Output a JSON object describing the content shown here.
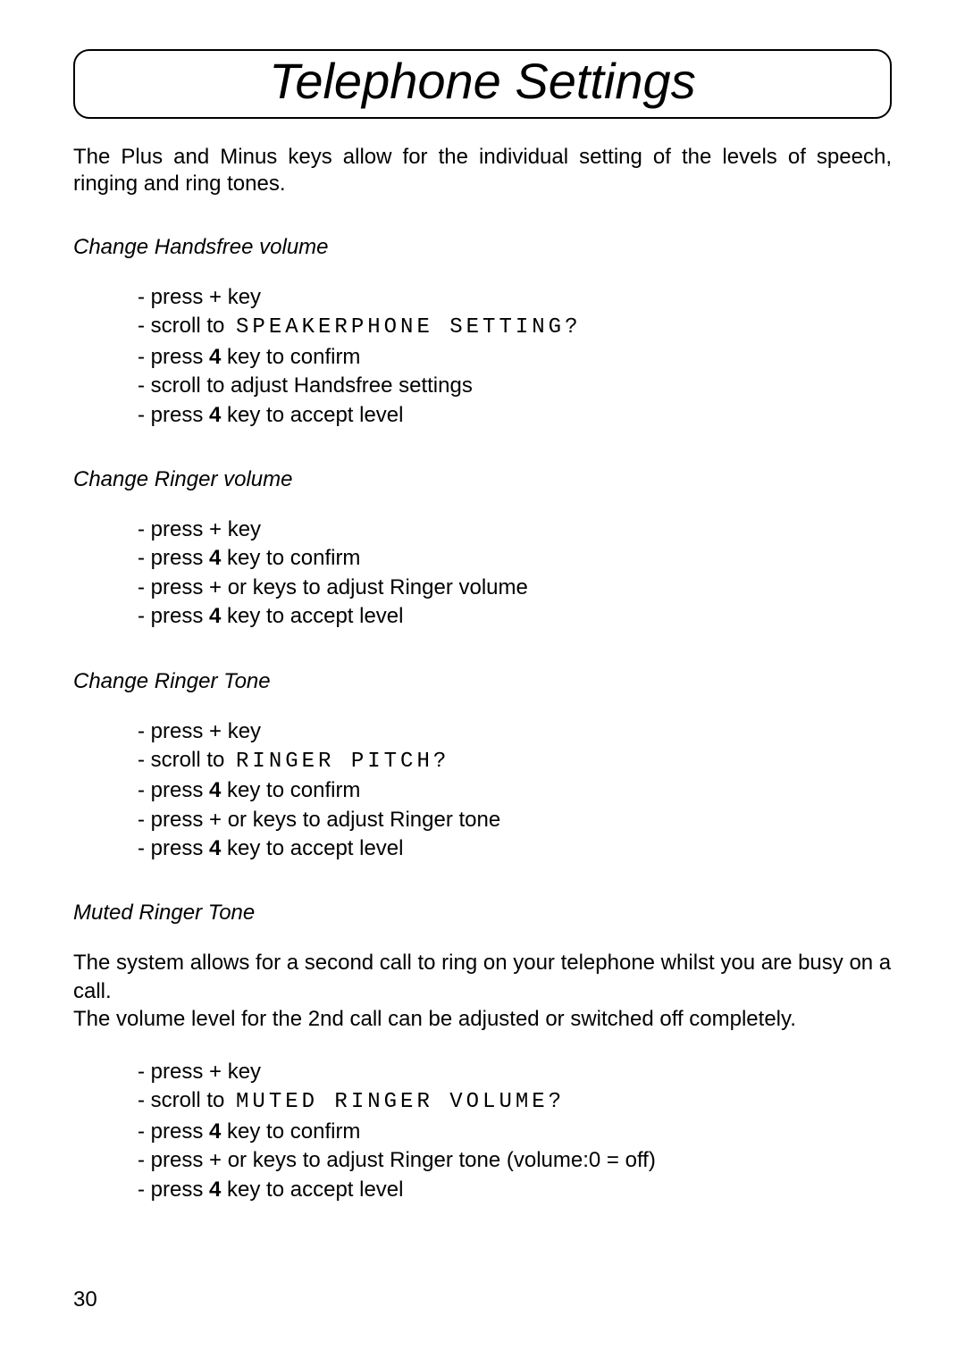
{
  "title": "Telephone Settings",
  "intro": "The Plus and Minus keys allow for the individual setting of the levels of speech, ringing and ring tones.",
  "sections": {
    "handsfree": {
      "label": "Change Handsfree volume",
      "steps": [
        {
          "pre": "- press + key"
        },
        {
          "pre": "- scroll to ",
          "lcd": "SPEAKERPHONE SETTING?"
        },
        {
          "pre": "- press  ",
          "bold": "4",
          "post": "   key to confirm"
        },
        {
          "pre": "- scroll to adjust Handsfree settings"
        },
        {
          "pre": "- press  ",
          "bold": "4",
          "post": "   key to accept level"
        }
      ]
    },
    "ringer_volume": {
      "label": "Change Ringer volume",
      "steps": [
        {
          "pre": "- press + key"
        },
        {
          "pre": "- press  ",
          "bold": "4",
          "post": "   key to confirm"
        },
        {
          "pre": "- press + or     keys to adjust Ringer volume"
        },
        {
          "pre": "- press  ",
          "bold": "4",
          "post": "   key to accept level"
        }
      ]
    },
    "ringer_tone": {
      "label": "Change Ringer Tone",
      "steps": [
        {
          "pre": "- press + key"
        },
        {
          "pre": "- scroll to ",
          "lcd": "RINGER PITCH?"
        },
        {
          "pre": "- press  ",
          "bold": "4",
          "post": "   key to confirm"
        },
        {
          "pre": "- press + or    keys to adjust Ringer tone"
        },
        {
          "pre": "- press  ",
          "bold": "4",
          "post": "   key to accept level"
        }
      ]
    },
    "muted_ringer": {
      "label": "Muted Ringer Tone",
      "para1": "The system allows for a second call to ring on your telephone whilst you are busy on a call.",
      "para2": "The volume level for the 2nd call can be adjusted or switched off completely.",
      "steps": [
        {
          "pre": "- press + key"
        },
        {
          "pre": "- scroll to ",
          "lcd": "MUTED RINGER VOLUME?"
        },
        {
          "pre": "- press  ",
          "bold": "4",
          "post": "   key to confirm"
        },
        {
          "pre": "- press + or    keys to adjust Ringer tone (volume:0 = off)"
        },
        {
          "pre": "- press  ",
          "bold": "4",
          "post": "   key to accept level"
        }
      ]
    }
  },
  "page_number": "30"
}
